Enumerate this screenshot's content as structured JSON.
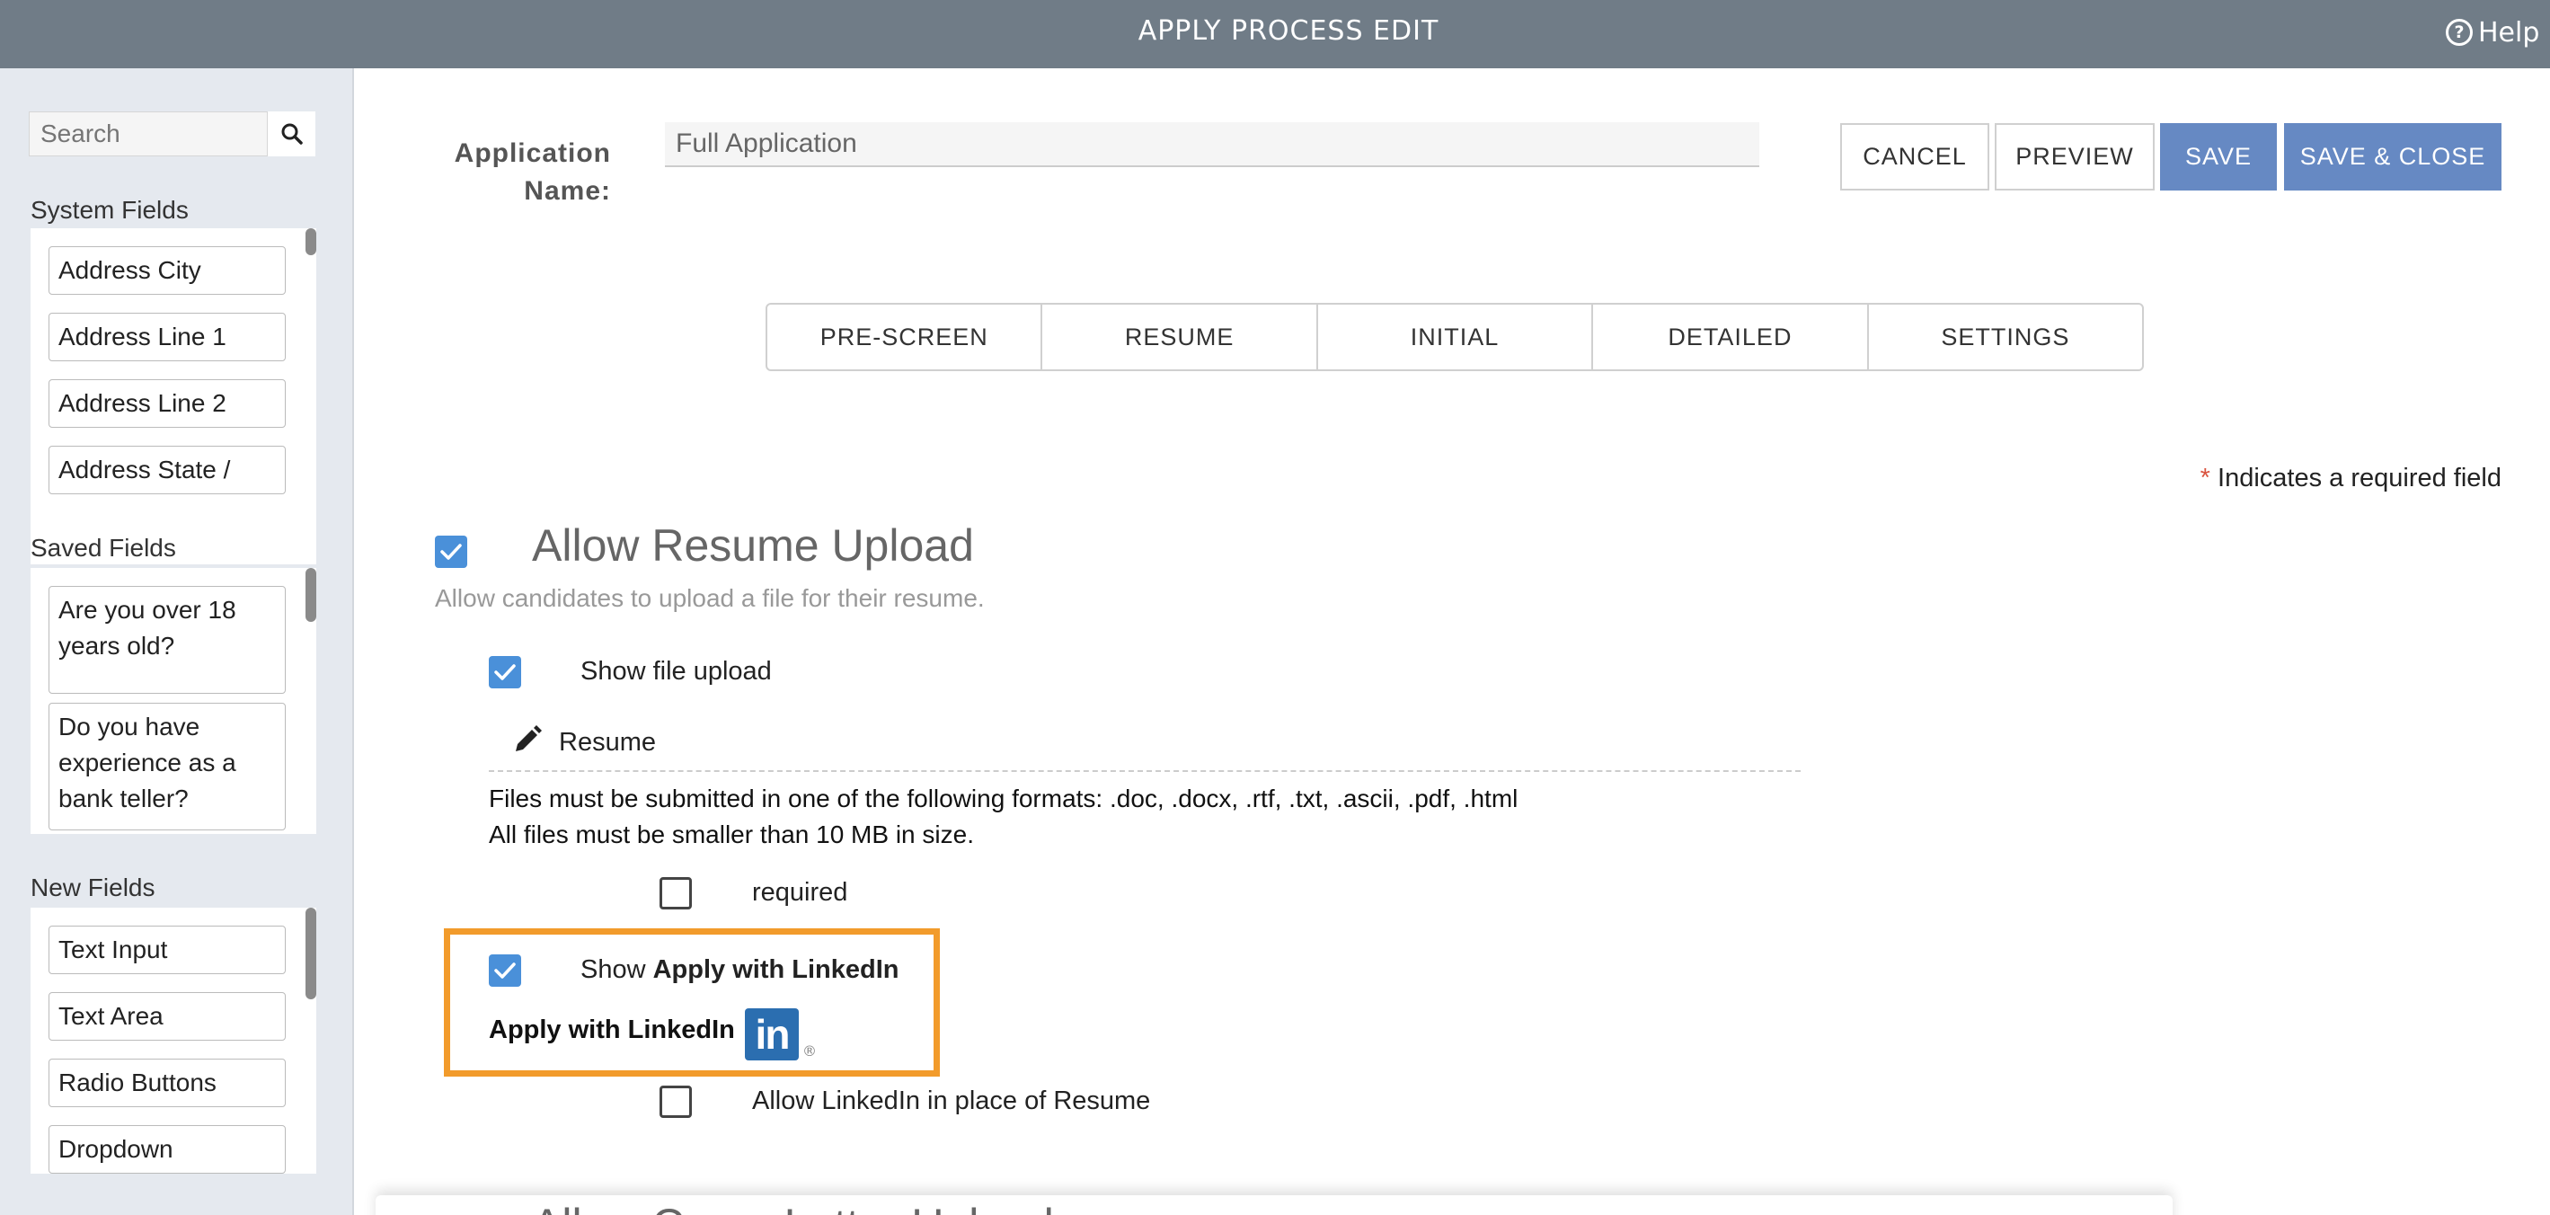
{
  "header": {
    "title": "APPLY PROCESS EDIT",
    "help_label": "Help"
  },
  "sidebar": {
    "search_placeholder": "Search",
    "sections": {
      "system": {
        "label": "System Fields",
        "items": [
          "Address City",
          "Address Line 1",
          "Address Line 2",
          "Address State /"
        ]
      },
      "saved": {
        "label": "Saved Fields",
        "items": [
          "Are you over 18 years old?",
          "Do you have experience as a bank teller?"
        ]
      },
      "new": {
        "label": "New Fields",
        "items": [
          "Text Input",
          "Text Area",
          "Radio Buttons",
          "Dropdown"
        ]
      }
    }
  },
  "form": {
    "app_name_label": "Application Name:",
    "app_name_value": "Full Application"
  },
  "actions": {
    "cancel": "CANCEL",
    "preview": "PREVIEW",
    "save": "SAVE",
    "save_close": "SAVE & CLOSE"
  },
  "tabs": [
    "PRE-SCREEN",
    "RESUME",
    "INITIAL",
    "DETAILED",
    "SETTINGS"
  ],
  "required_note": {
    "star": "*",
    "text": "Indicates a required field"
  },
  "resume": {
    "title": "Allow Resume Upload",
    "description": "Allow candidates to upload a file for their resume.",
    "allow_checked": true,
    "show_file_upload": {
      "label": "Show file upload",
      "checked": true
    },
    "field_label": "Resume",
    "formats_text": "Files must be submitted in one of the following formats: .doc, .docx, .rtf, .txt, .ascii, .pdf, .html",
    "size_text": "All files must be smaller than 10 MB in size.",
    "required": {
      "label": "required",
      "checked": false
    },
    "linkedin": {
      "show_prefix": "Show ",
      "show_bold": "Apply with LinkedIn",
      "checked": true,
      "button_text": "Apply with LinkedIn",
      "logo_text": "in",
      "registered": "®"
    },
    "allow_linkedin": {
      "label": "Allow LinkedIn in place of Resume",
      "checked": false
    }
  },
  "next_section": {
    "title": "Allow Cover Letter Upload"
  },
  "colors": {
    "header_bg": "#707c87",
    "primary": "#6689c3",
    "checkbox": "#4a90d9",
    "highlight": "#f29b2b",
    "linkedin": "#2b6eb0"
  }
}
